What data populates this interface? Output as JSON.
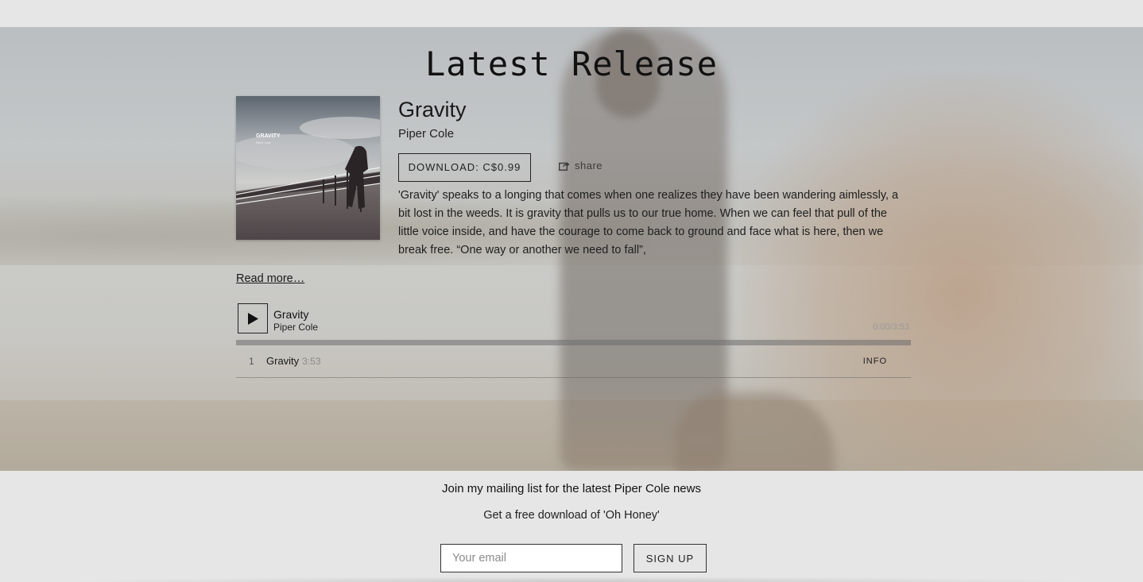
{
  "section": {
    "title": "Latest Release"
  },
  "release": {
    "cover": {
      "title_text": "GRAVITY",
      "artist_text": "Piper Cole"
    },
    "title": "Gravity",
    "artist": "Piper Cole",
    "download_label": "DOWNLOAD: C$0.99",
    "share_label": "share",
    "share_icon": "share-icon",
    "description": "'Gravity' speaks to a longing that comes when one realizes they have been wandering aimlessly, a bit lost in the weeds. It is gravity that pulls us to our true home. When we can feel that pull of the little voice inside, and have the courage to come back to ground and face what is here, then we break free. “One way or another we need to fall”,",
    "read_more": "Read more…"
  },
  "player": {
    "play_icon": "play-icon",
    "now_playing_title": "Gravity",
    "now_playing_artist": "Piper Cole",
    "time": "0:00/3:53",
    "progress": 0,
    "tracks": [
      {
        "number": "1",
        "title": "Gravity",
        "duration": "3:53",
        "info_label": "INFO"
      }
    ]
  },
  "mailing": {
    "heading": "Join my mailing list for the latest Piper Cole news",
    "subheading": "Get a free download of 'Oh Honey'",
    "email_placeholder": "Your email",
    "signup_label": "SIGN UP"
  }
}
